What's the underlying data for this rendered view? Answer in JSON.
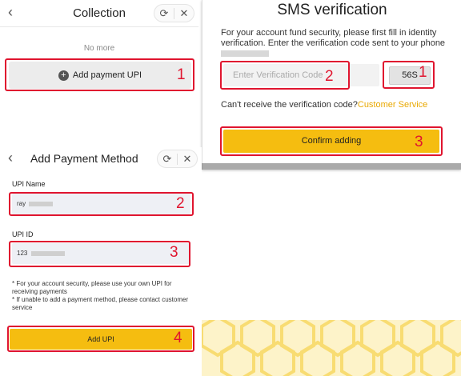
{
  "collection": {
    "title": "Collection",
    "back_icon": "chevron-left-icon",
    "refresh_icon": "refresh-icon",
    "close_icon": "close-icon",
    "no_more": "No more",
    "add_button_label": "Add payment UPI",
    "step": "1"
  },
  "sms": {
    "title": "SMS verification",
    "description": "For your account fund security, please first fill in identity verification. Enter the verification code sent to your phone",
    "code_placeholder": "Enter Verification Code",
    "timer": "56S",
    "cant_receive": "Can't receive the verification code?",
    "customer_service": "Customer Service",
    "confirm_label": "Confirm adding",
    "steps": [
      "1",
      "2",
      "3"
    ]
  },
  "add_method": {
    "title": "Add Payment Method",
    "upi_name_label": "UPI Name",
    "upi_name_value": "ray",
    "upi_id_label": "UPI ID",
    "upi_id_value": "123",
    "note1": "* For your account security, please use your own UPI for receiving payments",
    "note2": "* If unable to add a payment method, please contact customer service",
    "add_label": "Add UPI",
    "steps": [
      "2",
      "3",
      "4"
    ]
  },
  "colors": {
    "accent": "#f5bd10",
    "highlight": "#e0152f",
    "link": "#e9a800"
  }
}
